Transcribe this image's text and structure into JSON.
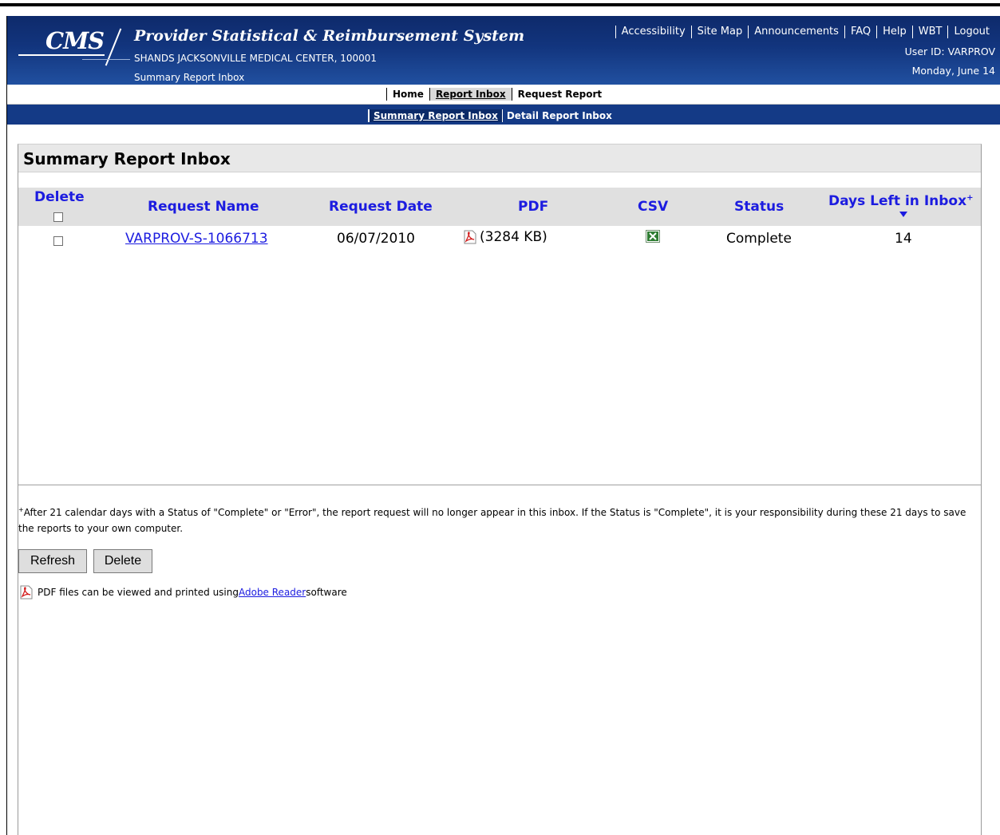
{
  "header": {
    "logo_text": "CMS",
    "system_title": "Provider Statistical & Reimbursement System",
    "provider_line": "SHANDS JACKSONVILLE MEDICAL CENTER, 100001",
    "breadcrumb": "Summary Report Inbox",
    "top_links": [
      "Accessibility",
      "Site Map",
      "Announcements",
      "FAQ",
      "Help",
      "WBT",
      "Logout"
    ],
    "user_id": "User ID: VARPROV",
    "date": "Monday, June 14"
  },
  "nav_primary": [
    {
      "label": "Home",
      "active": false
    },
    {
      "label": "Report Inbox",
      "active": true
    },
    {
      "label": "Request Report",
      "active": false
    }
  ],
  "nav_secondary": [
    {
      "label": "Summary Report Inbox",
      "active": true
    },
    {
      "label": "Detail Report Inbox",
      "active": false
    }
  ],
  "panel": {
    "title": "Summary Report Inbox",
    "columns": {
      "delete": "Delete",
      "request_name": "Request Name",
      "request_date": "Request Date",
      "pdf": "PDF",
      "csv": "CSV",
      "status": "Status",
      "days_left": "Days Left in Inbox",
      "days_left_mark": "+"
    },
    "rows": [
      {
        "request_name": "VARPROV-S-1066713",
        "request_date": "06/07/2010",
        "pdf_size": "(3284 KB)",
        "status": "Complete",
        "days_left": "14"
      }
    ],
    "footnote_mark": "+",
    "footnote": "After 21 calendar days with a Status of \"Complete\" or \"Error\", the report request will no longer appear in this inbox.  If  the Status is \"Complete\", it is your responsibility during these 21 days to save the reports to your own computer.",
    "buttons": {
      "refresh": "Refresh",
      "delete": "Delete"
    },
    "pdf_note_before": "PDF files can be viewed and printed using ",
    "pdf_note_link": "Adobe Reader",
    "pdf_note_after": " software"
  },
  "icons": {
    "pdf": "pdf-icon",
    "csv": "excel-icon",
    "sort": "sort-desc-icon"
  },
  "colors": {
    "header_blue": "#12357e",
    "link_blue": "#1c1ce0",
    "table_header_gray": "#e0e0e0"
  }
}
